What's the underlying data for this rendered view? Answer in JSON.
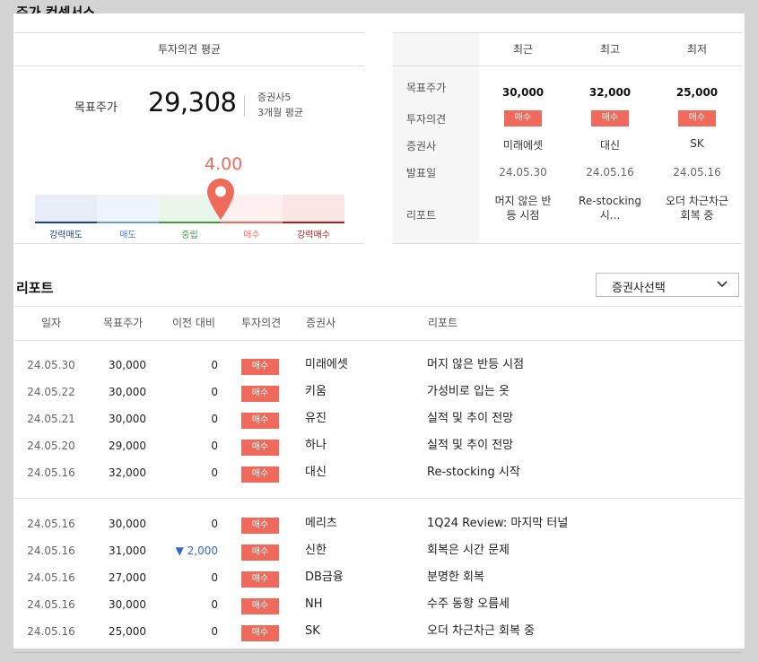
{
  "page": {
    "title": "주가 컨센서스"
  },
  "summary": {
    "header": "투자의견 평균",
    "target_label": "목표주가",
    "target_value": "29,308",
    "firm_count": "증권사5",
    "period": "3개월 평균",
    "score": "4.00",
    "score_value": 4.0,
    "scale_labels": [
      "강력매도",
      "매도",
      "중립",
      "매수",
      "강력매수"
    ]
  },
  "consensus": {
    "columns": [
      "최근",
      "최고",
      "최저"
    ],
    "row_labels": [
      "목표주가",
      "투자의견",
      "증권사",
      "발표일",
      "리포트"
    ],
    "cells": [
      {
        "target": "30,000",
        "opinion": "매수",
        "firm": "미래에셋",
        "date": "24.05.30",
        "report_line1": "머지 않은 반",
        "report_line2": "등 시점"
      },
      {
        "target": "32,000",
        "opinion": "매수",
        "firm": "대신",
        "date": "24.05.16",
        "report_line1": "Re-stocking",
        "report_line2": "시..."
      },
      {
        "target": "25,000",
        "opinion": "매수",
        "firm": "SK",
        "date": "24.05.16",
        "report_line1": "오더 차근차근",
        "report_line2": "회복 중"
      }
    ]
  },
  "reports": {
    "title": "리포트",
    "firm_select": "증권사선택",
    "headers": [
      "일자",
      "목표주가",
      "이전 대비",
      "투자의견",
      "증권사",
      "리포트"
    ],
    "rows": [
      {
        "date": "24.05.30",
        "target": "30,000",
        "change": "0",
        "opinion": "매수",
        "firm": "미래에셋",
        "title": "머지 않은 반등 시점"
      },
      {
        "date": "24.05.22",
        "target": "30,000",
        "change": "0",
        "opinion": "매수",
        "firm": "키움",
        "title": "가성비로 입는 옷"
      },
      {
        "date": "24.05.21",
        "target": "30,000",
        "change": "0",
        "opinion": "매수",
        "firm": "유진",
        "title": "실적 및 추이 전망"
      },
      {
        "date": "24.05.20",
        "target": "29,000",
        "change": "0",
        "opinion": "매수",
        "firm": "하나",
        "title": "실적 및 추이 전망"
      },
      {
        "date": "24.05.16",
        "target": "32,000",
        "change": "0",
        "opinion": "매수",
        "firm": "대신",
        "title": "Re-stocking 시작"
      },
      {
        "date": "24.05.16",
        "target": "30,000",
        "change": "0",
        "opinion": "매수",
        "firm": "메리츠",
        "title": "1Q24 Review: 마지막 터널"
      },
      {
        "date": "24.05.16",
        "target": "31,000",
        "change": "▼ 2,000",
        "opinion": "매수",
        "firm": "신한",
        "title": "회복은 시간 문제"
      },
      {
        "date": "24.05.16",
        "target": "27,000",
        "change": "0",
        "opinion": "매수",
        "firm": "DB금융",
        "title": "분명한 회복"
      },
      {
        "date": "24.05.16",
        "target": "30,000",
        "change": "0",
        "opinion": "매수",
        "firm": "NH",
        "title": "수주 동향 오름세"
      },
      {
        "date": "24.05.16",
        "target": "25,000",
        "change": "0",
        "opinion": "매수",
        "firm": "SK",
        "title": "오더 차근차근 회복 중"
      }
    ]
  },
  "colors": {
    "buy": "#f06a5c",
    "down": "#3366cc",
    "strong_sell": "#1f3f8f",
    "sell": "#6f9ad8",
    "neutral": "#3f9a45",
    "buy_scale": "#f06a5c",
    "strong_buy": "#b71c1c"
  },
  "icons": {
    "marker": "location-pin-icon",
    "dropdown": "chevron-down-icon"
  }
}
